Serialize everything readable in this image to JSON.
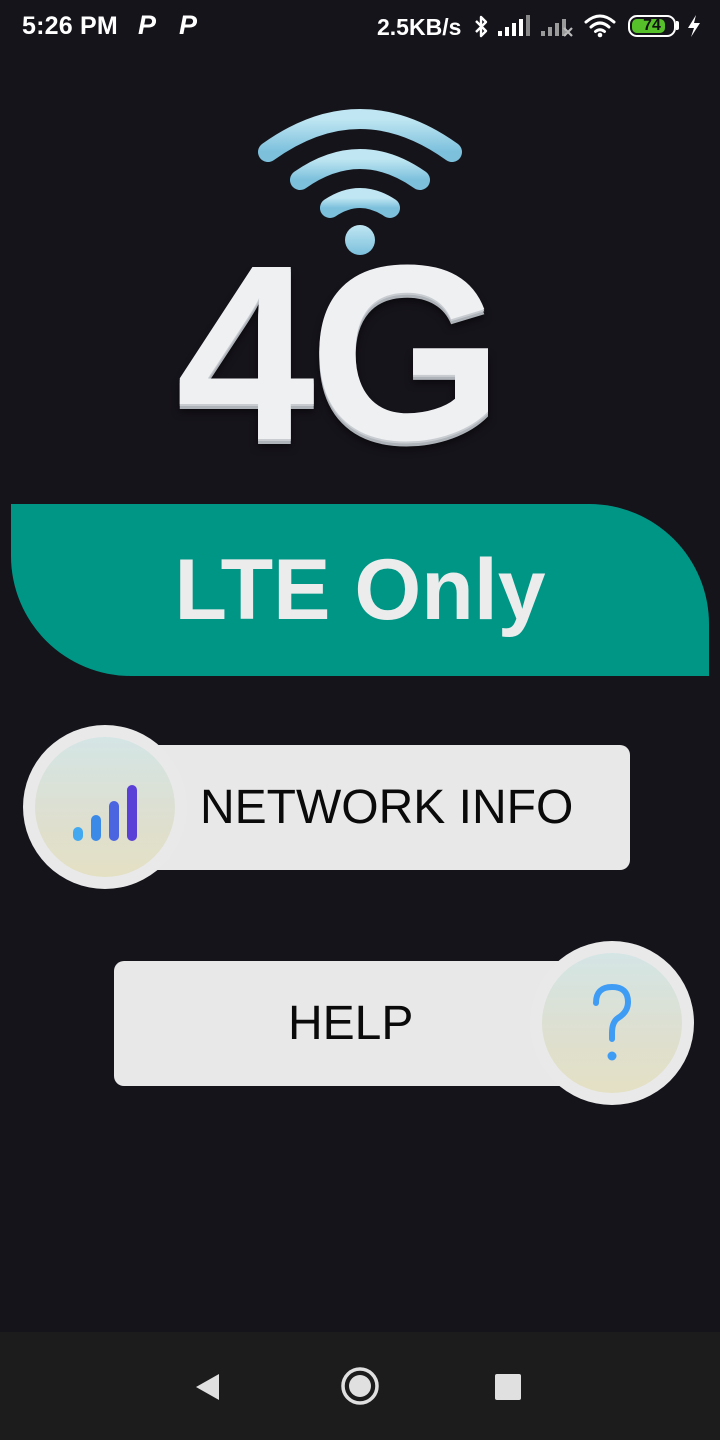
{
  "status_bar": {
    "time": "5:26 PM",
    "notification_icons": [
      "P",
      "P"
    ],
    "network_speed": "2.5KB/s",
    "icons": [
      "bluetooth-icon",
      "signal-icon",
      "signal-no-service-icon",
      "wifi-icon"
    ],
    "battery_level": "74",
    "charging_icon": "bolt-icon"
  },
  "hero": {
    "wifi_icon": "wifi-icon",
    "logo_text": "4G"
  },
  "banner": {
    "label": "LTE Only",
    "color": "#009686"
  },
  "buttons": {
    "network_info": {
      "label": "NETWORK INFO",
      "icon": "signal-bars-icon"
    },
    "help": {
      "label": "HELP",
      "icon": "question-mark-icon"
    }
  },
  "nav_bar": {
    "back": "back-icon",
    "home": "home-icon",
    "recents": "recents-icon"
  },
  "colors": {
    "background": "#16141b",
    "button_bg": "#e8e8e8",
    "signal_bars": "#4a4ee0",
    "question_mark": "#3f9cf5"
  }
}
